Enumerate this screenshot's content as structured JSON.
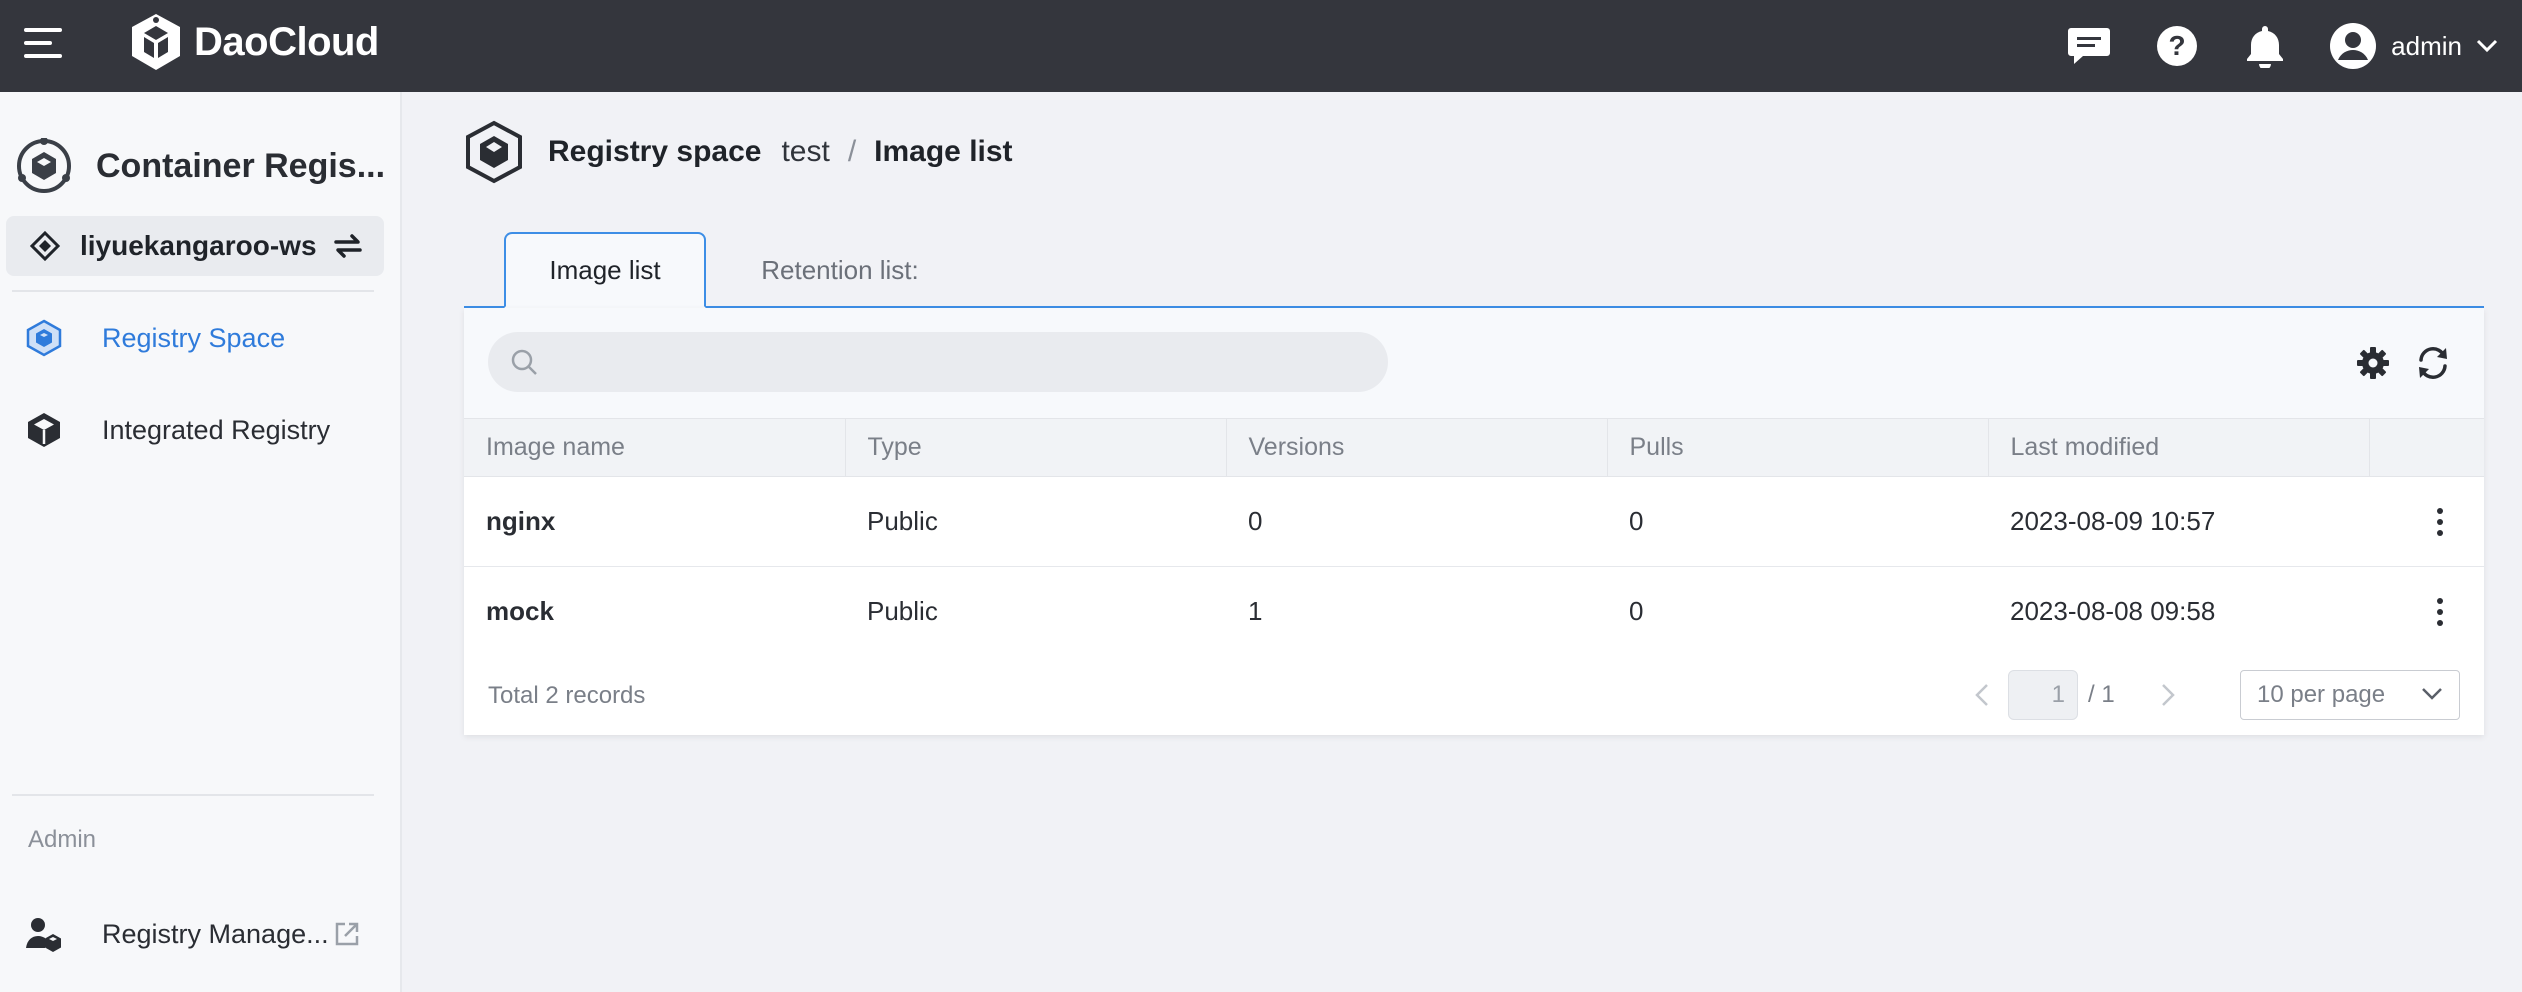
{
  "topbar": {
    "brand": "DaoCloud",
    "user_name": "admin",
    "icons": [
      "menu-icon",
      "message-icon",
      "help-icon",
      "bell-icon",
      "user-avatar-icon",
      "chevron-down-icon"
    ]
  },
  "sidebar": {
    "app_title": "Container Regis...",
    "workspace": "liyuekangaroo-ws",
    "items": [
      {
        "label": "Registry Space",
        "icon": "registry-space-icon",
        "active": true
      },
      {
        "label": "Integrated Registry",
        "icon": "cube-icon",
        "active": false
      }
    ],
    "admin_section": "Admin",
    "admin_items": [
      {
        "label": "Registry Manage...",
        "icon": "user-cube-icon"
      }
    ],
    "accent_color": "#2f7bdb"
  },
  "breadcrumb": {
    "section": "Registry space",
    "space": "test",
    "separator": "/",
    "current": "Image list"
  },
  "tabs": [
    {
      "label": "Image list",
      "active": true
    },
    {
      "label": "Retention list:",
      "active": false
    }
  ],
  "search": {
    "placeholder": "",
    "value": ""
  },
  "table": {
    "columns": [
      "Image name",
      "Type",
      "Versions",
      "Pulls",
      "Last modified",
      ""
    ],
    "rows": [
      {
        "name": "nginx",
        "type": "Public",
        "versions": "0",
        "pulls": "0",
        "modified": "2023-08-09 10:57"
      },
      {
        "name": "mock",
        "type": "Public",
        "versions": "1",
        "pulls": "0",
        "modified": "2023-08-08 09:58"
      }
    ]
  },
  "pagination": {
    "total_text": "Total 2 records",
    "current_page": "1",
    "total_pages": "/ 1",
    "page_size": "10 per page"
  }
}
